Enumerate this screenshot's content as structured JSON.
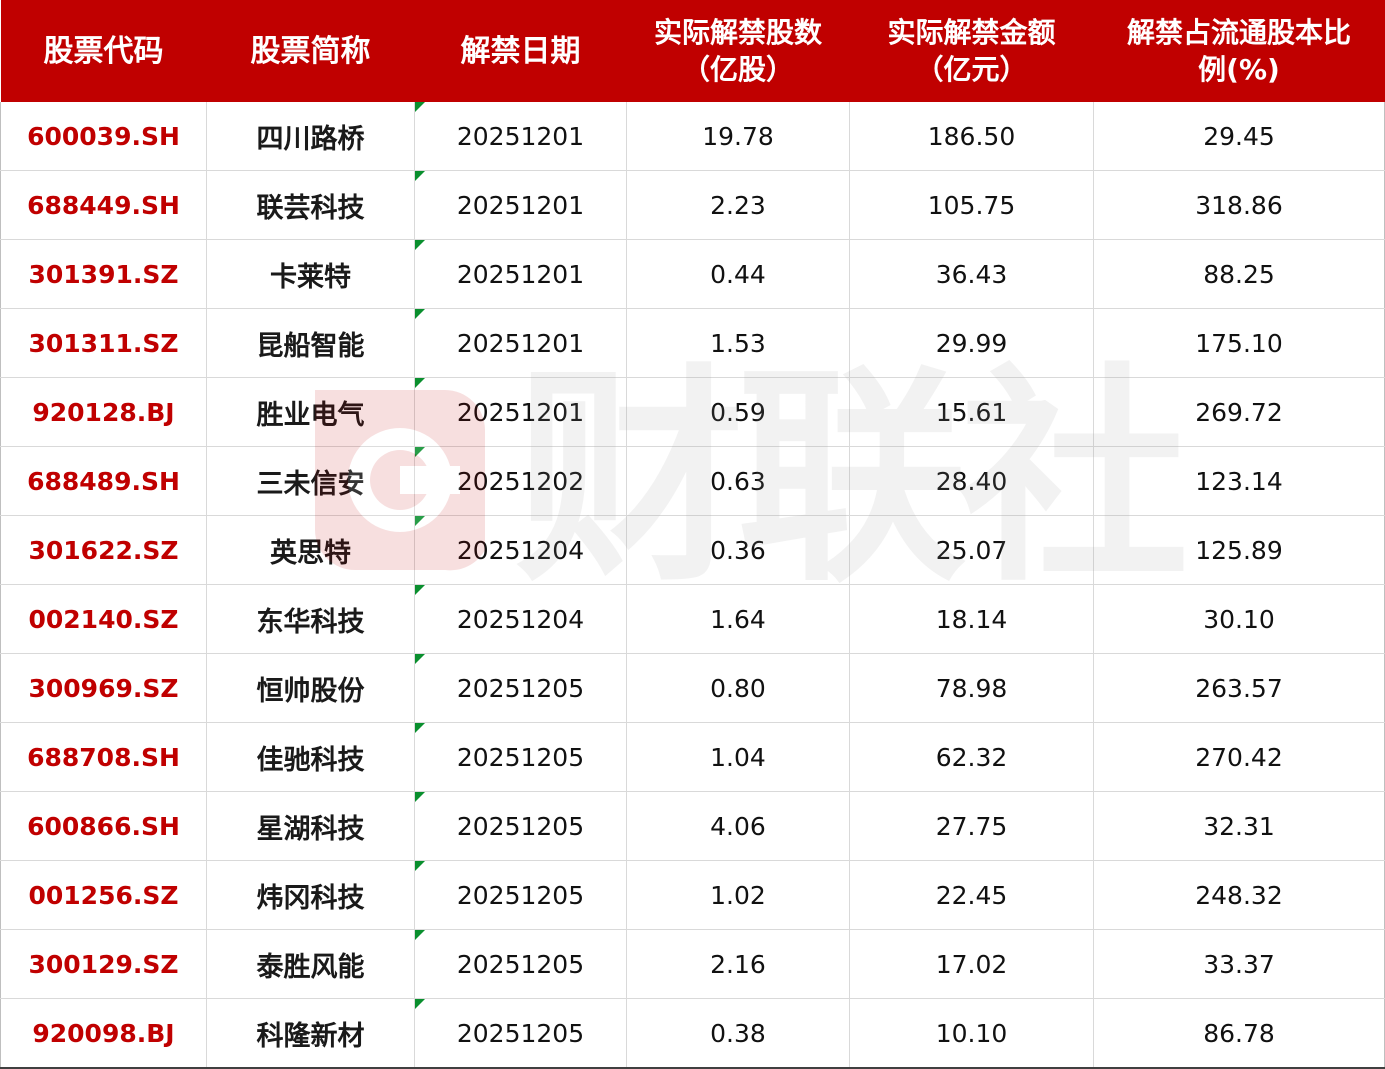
{
  "table": {
    "headers": [
      {
        "line1": "股票代码",
        "line2": ""
      },
      {
        "line1": "股票简称",
        "line2": ""
      },
      {
        "line1": "解禁日期",
        "line2": ""
      },
      {
        "line1": "实际解禁股数",
        "line2": "（亿股）"
      },
      {
        "line1": "实际解禁金额",
        "line2": "（亿元）"
      },
      {
        "line1": "解禁占流通股本比",
        "line2": "例(%)"
      }
    ],
    "rows": [
      [
        "600039.SH",
        "四川路桥",
        "20251201",
        "19.78",
        "186.50",
        "29.45"
      ],
      [
        "688449.SH",
        "联芸科技",
        "20251201",
        "2.23",
        "105.75",
        "318.86"
      ],
      [
        "301391.SZ",
        "卡莱特",
        "20251201",
        "0.44",
        "36.43",
        "88.25"
      ],
      [
        "301311.SZ",
        "昆船智能",
        "20251201",
        "1.53",
        "29.99",
        "175.10"
      ],
      [
        "920128.BJ",
        "胜业电气",
        "20251201",
        "0.59",
        "15.61",
        "269.72"
      ],
      [
        "688489.SH",
        "三未信安",
        "20251202",
        "0.63",
        "28.40",
        "123.14"
      ],
      [
        "301622.SZ",
        "英思特",
        "20251204",
        "0.36",
        "25.07",
        "125.89"
      ],
      [
        "002140.SZ",
        "东华科技",
        "20251204",
        "1.64",
        "18.14",
        "30.10"
      ],
      [
        "300969.SZ",
        "恒帅股份",
        "20251205",
        "0.80",
        "78.98",
        "263.57"
      ],
      [
        "688708.SH",
        "佳驰科技",
        "20251205",
        "1.04",
        "62.32",
        "270.42"
      ],
      [
        "600866.SH",
        "星湖科技",
        "20251205",
        "4.06",
        "27.75",
        "32.31"
      ],
      [
        "001256.SZ",
        "炜冈科技",
        "20251205",
        "1.02",
        "22.45",
        "248.32"
      ],
      [
        "300129.SZ",
        "泰胜风能",
        "20251205",
        "2.16",
        "17.02",
        "33.37"
      ],
      [
        "920098.BJ",
        "科隆新材",
        "20251205",
        "0.38",
        "10.10",
        "86.78"
      ]
    ]
  },
  "watermark": {
    "text": "财联社",
    "icon": "cls-logo-icon"
  },
  "colors": {
    "header_bg": "#c00000",
    "code_text": "#c00000",
    "cell_marker": "#0a8f2e"
  }
}
